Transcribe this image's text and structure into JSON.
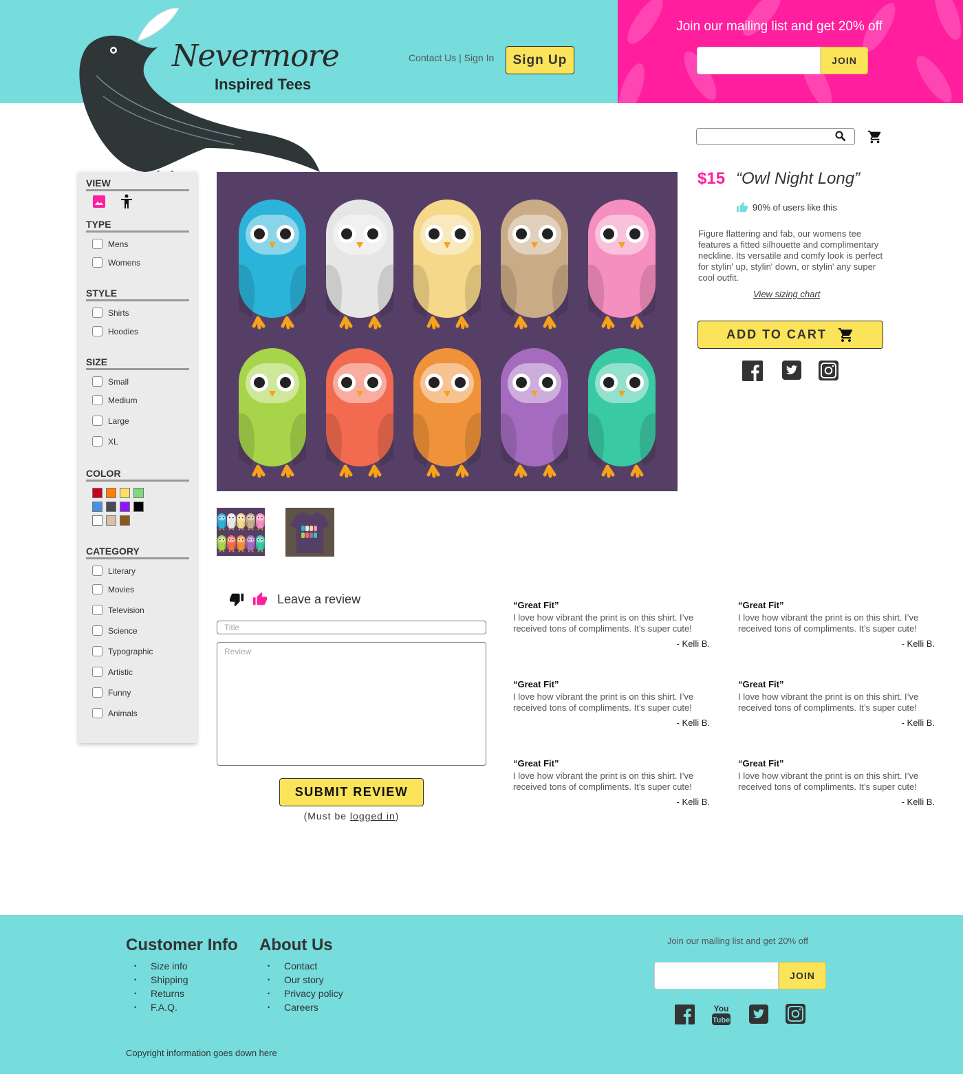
{
  "brand": {
    "name": "Nevermore",
    "tagline": "Inspired Tees"
  },
  "header": {
    "contact": "Contact Us",
    "separator": "|",
    "signin": "Sign In",
    "signup": "Sign Up"
  },
  "promo": {
    "text": "Join our mailing list and get 20% off",
    "join": "JOIN"
  },
  "filters": {
    "view": "VIEW",
    "type": {
      "title": "TYPE",
      "items": [
        "Mens",
        "Womens"
      ]
    },
    "style": {
      "title": "STYLE",
      "items": [
        "Shirts",
        "Hoodies"
      ]
    },
    "size": {
      "title": "SIZE",
      "items": [
        "Small",
        "Medium",
        "Large",
        "XL"
      ]
    },
    "color": {
      "title": "COLOR",
      "swatches": [
        "#c8001e",
        "#ff7f00",
        "#ffe066",
        "#7ed97e",
        "#4a90e2",
        "#4a4a55",
        "#9013fe",
        "#000000",
        "#ffffff",
        "#d8c0a8",
        "#8b5a1a"
      ]
    },
    "category": {
      "title": "CATEGORY",
      "items": [
        "Literary",
        "Movies",
        "Television",
        "Science",
        "Typographic",
        "Artistic",
        "Funny",
        "Animals"
      ]
    }
  },
  "product": {
    "price": "$15",
    "title": "“Owl Night Long”",
    "likes": "90% of users like this",
    "description": "Figure flattering and fab, our womens tee features a fitted silhouette and complimentary neckline. Its versatile and comfy look is perfect for stylin' up, stylin' down, or stylin' any super cool outfit.",
    "sizing": "View sizing chart",
    "add_to_cart": "ADD TO CART"
  },
  "review_form": {
    "heading": "Leave a review",
    "title_placeholder": "Title",
    "review_placeholder": "Review",
    "submit": "SUBMIT REVIEW",
    "must_prefix": "(Must be ",
    "must_link": "logged in",
    "must_suffix": ")"
  },
  "reviews": [
    {
      "title": "“Great Fit”",
      "body": "I love how vibrant the print is on this shirt. I’ve received tons of compliments. It’s super cute!",
      "author": "- Kelli B."
    },
    {
      "title": "“Great Fit”",
      "body": "I love how vibrant the print is on this shirt. I’ve received tons of compliments. It’s super cute!",
      "author": "- Kelli B."
    },
    {
      "title": "“Great Fit”",
      "body": "I love how vibrant the print is on this shirt. I’ve received tons of compliments. It’s super cute!",
      "author": "- Kelli B."
    },
    {
      "title": "“Great Fit”",
      "body": "I love how vibrant the print is on this shirt. I’ve received tons of compliments. It’s super cute!",
      "author": "- Kelli B."
    },
    {
      "title": "“Great Fit”",
      "body": "I love how vibrant the print is on this shirt. I’ve received tons of compliments. It’s super cute!",
      "author": "- Kelli B."
    },
    {
      "title": "“Great Fit”",
      "body": "I love how vibrant the print is on this shirt. I’ve received tons of compliments. It’s super cute!",
      "author": "- Kelli B."
    }
  ],
  "owls": [
    "#2bb3d9",
    "#e6e6e6",
    "#f5d889",
    "#c9ab86",
    "#f58fbf",
    "#a8d44a",
    "#f26a4f",
    "#f0923a",
    "#a46bbf",
    "#39c9a3"
  ],
  "footer": {
    "customer_info": {
      "title": "Customer Info",
      "items": [
        "Size info",
        "Shipping",
        "Returns",
        "F.A.Q."
      ]
    },
    "about": {
      "title": "About Us",
      "items": [
        "Contact",
        "Our story",
        "Privacy policy",
        "Careers"
      ]
    },
    "mailing": "Join our mailing list and get 20% off",
    "join": "JOIN",
    "copyright": "Copyright information goes down here"
  },
  "colors": {
    "teal": "#76dcdc",
    "pink": "#ff1f9e",
    "yellow": "#fbe35a",
    "purple": "#563f66"
  }
}
